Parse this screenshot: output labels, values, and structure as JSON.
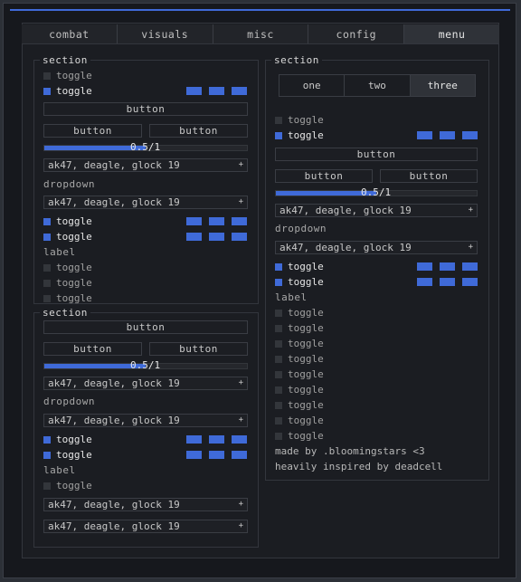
{
  "tabs": [
    {
      "label": "combat"
    },
    {
      "label": "visuals"
    },
    {
      "label": "misc"
    },
    {
      "label": "config"
    },
    {
      "label": "menu",
      "active": true
    }
  ],
  "colors": {
    "accent": "#3f6ad8",
    "background": "#1b1d22",
    "checkbox_off": "#33363b"
  },
  "left_top": {
    "title": "section",
    "toggle1": {
      "label": "toggle",
      "checked": false
    },
    "toggle2": {
      "label": "toggle",
      "checked": true,
      "swatches": 3
    },
    "button_wide": "button",
    "button_a": "button",
    "button_b": "button",
    "slider": {
      "value_text": "0.5/1",
      "fraction": 0.5
    },
    "select1": "ak47, deagle, glock 19",
    "dropdown_label": "dropdown",
    "select2": "ak47, deagle, glock 19",
    "toggle3": {
      "label": "toggle",
      "checked": true
    },
    "toggle4": {
      "label": "toggle",
      "checked": true
    },
    "label": "label",
    "toggle5": {
      "label": "toggle",
      "checked": false
    },
    "toggle6": {
      "label": "toggle",
      "checked": false
    },
    "toggle7": {
      "label": "toggle",
      "checked": false
    }
  },
  "left_bottom": {
    "title": "section",
    "button_wide": "button",
    "button_a": "button",
    "button_b": "button",
    "slider": {
      "value_text": "0.5/1",
      "fraction": 0.5
    },
    "select1": "ak47, deagle, glock 19",
    "dropdown_label": "dropdown",
    "select2": "ak47, deagle, glock 19",
    "toggle1": {
      "label": "toggle",
      "checked": true
    },
    "toggle2": {
      "label": "toggle",
      "checked": true
    },
    "label": "label",
    "toggle3": {
      "label": "toggle",
      "checked": false
    },
    "select3": "ak47, deagle, glock 19",
    "select4": "ak47, deagle, glock 19"
  },
  "right": {
    "title": "section",
    "segments": [
      "one",
      "two",
      "three"
    ],
    "active_segment": "three",
    "toggle1": {
      "label": "toggle",
      "checked": false
    },
    "toggle2": {
      "label": "toggle",
      "checked": true
    },
    "button_wide": "button",
    "button_a": "button",
    "button_b": "button",
    "slider": {
      "value_text": "0.5/1",
      "fraction": 0.5
    },
    "select1": "ak47, deagle, glock 19",
    "dropdown_label": "dropdown",
    "select2": "ak47, deagle, glock 19",
    "toggle3": {
      "label": "toggle",
      "checked": true
    },
    "toggle4": {
      "label": "toggle",
      "checked": true
    },
    "label": "label",
    "toggles_off": [
      "toggle",
      "toggle",
      "toggle",
      "toggle",
      "toggle",
      "toggle",
      "toggle",
      "toggle",
      "toggle"
    ],
    "credit1": "made by .bloomingstars <3",
    "credit2": "heavily inspired by deadcell"
  }
}
